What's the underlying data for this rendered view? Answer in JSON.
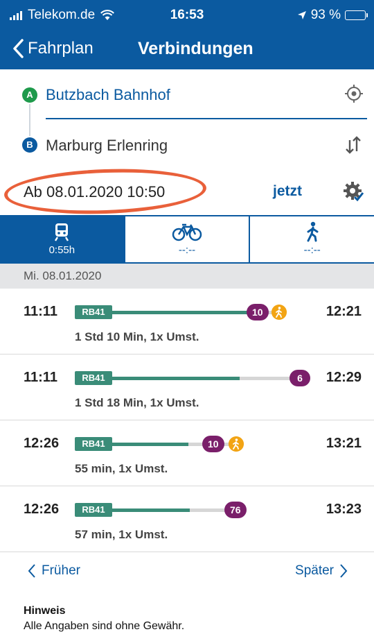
{
  "status_bar": {
    "carrier": "Telekom.de",
    "time": "16:53",
    "battery": "93 %",
    "battery_level": 0.93
  },
  "nav": {
    "back_label": "Fahrplan",
    "title": "Verbindungen"
  },
  "route": {
    "from_marker": "A",
    "from": "Butzbach Bahnhof",
    "to_marker": "B",
    "to": "Marburg Erlenring"
  },
  "datetime": {
    "label": "Ab 08.01.2020 10:50",
    "now_label": "jetzt"
  },
  "modes": [
    {
      "icon": "train-icon",
      "value": "0:55h",
      "active": true
    },
    {
      "icon": "bike-icon",
      "value": "--:--",
      "active": false
    },
    {
      "icon": "walk-icon",
      "value": "--:--",
      "active": false
    }
  ],
  "day": "Mi. 08.01.2020",
  "connections": [
    {
      "dep": "11:11",
      "line": "RB41",
      "bus": "10",
      "walk": true,
      "arr": "12:21",
      "duration": "1 Std 10 Min,  1x Umst."
    },
    {
      "dep": "11:11",
      "line": "RB41",
      "bus": "6",
      "walk": false,
      "arr": "12:29",
      "duration": "1 Std 18 Min,  1x Umst."
    },
    {
      "dep": "12:26",
      "line": "RB41",
      "bus": "10",
      "walk": true,
      "arr": "13:21",
      "duration": "55 min,  1x Umst."
    },
    {
      "dep": "12:26",
      "line": "RB41",
      "bus": "76",
      "walk": false,
      "arr": "13:23",
      "duration": "57 min,  1x Umst."
    }
  ],
  "pager": {
    "earlier": "Früher",
    "later": "Später"
  },
  "note": {
    "heading": "Hinweis",
    "text": "Alle Angaben sind ohne Gewähr."
  },
  "colors": {
    "primary": "#0b5aa0",
    "train": "#3a8c78",
    "bus": "#7a1f6a",
    "walk": "#f2a414",
    "highlight": "#e9603a",
    "start": "#1e9a4b"
  }
}
